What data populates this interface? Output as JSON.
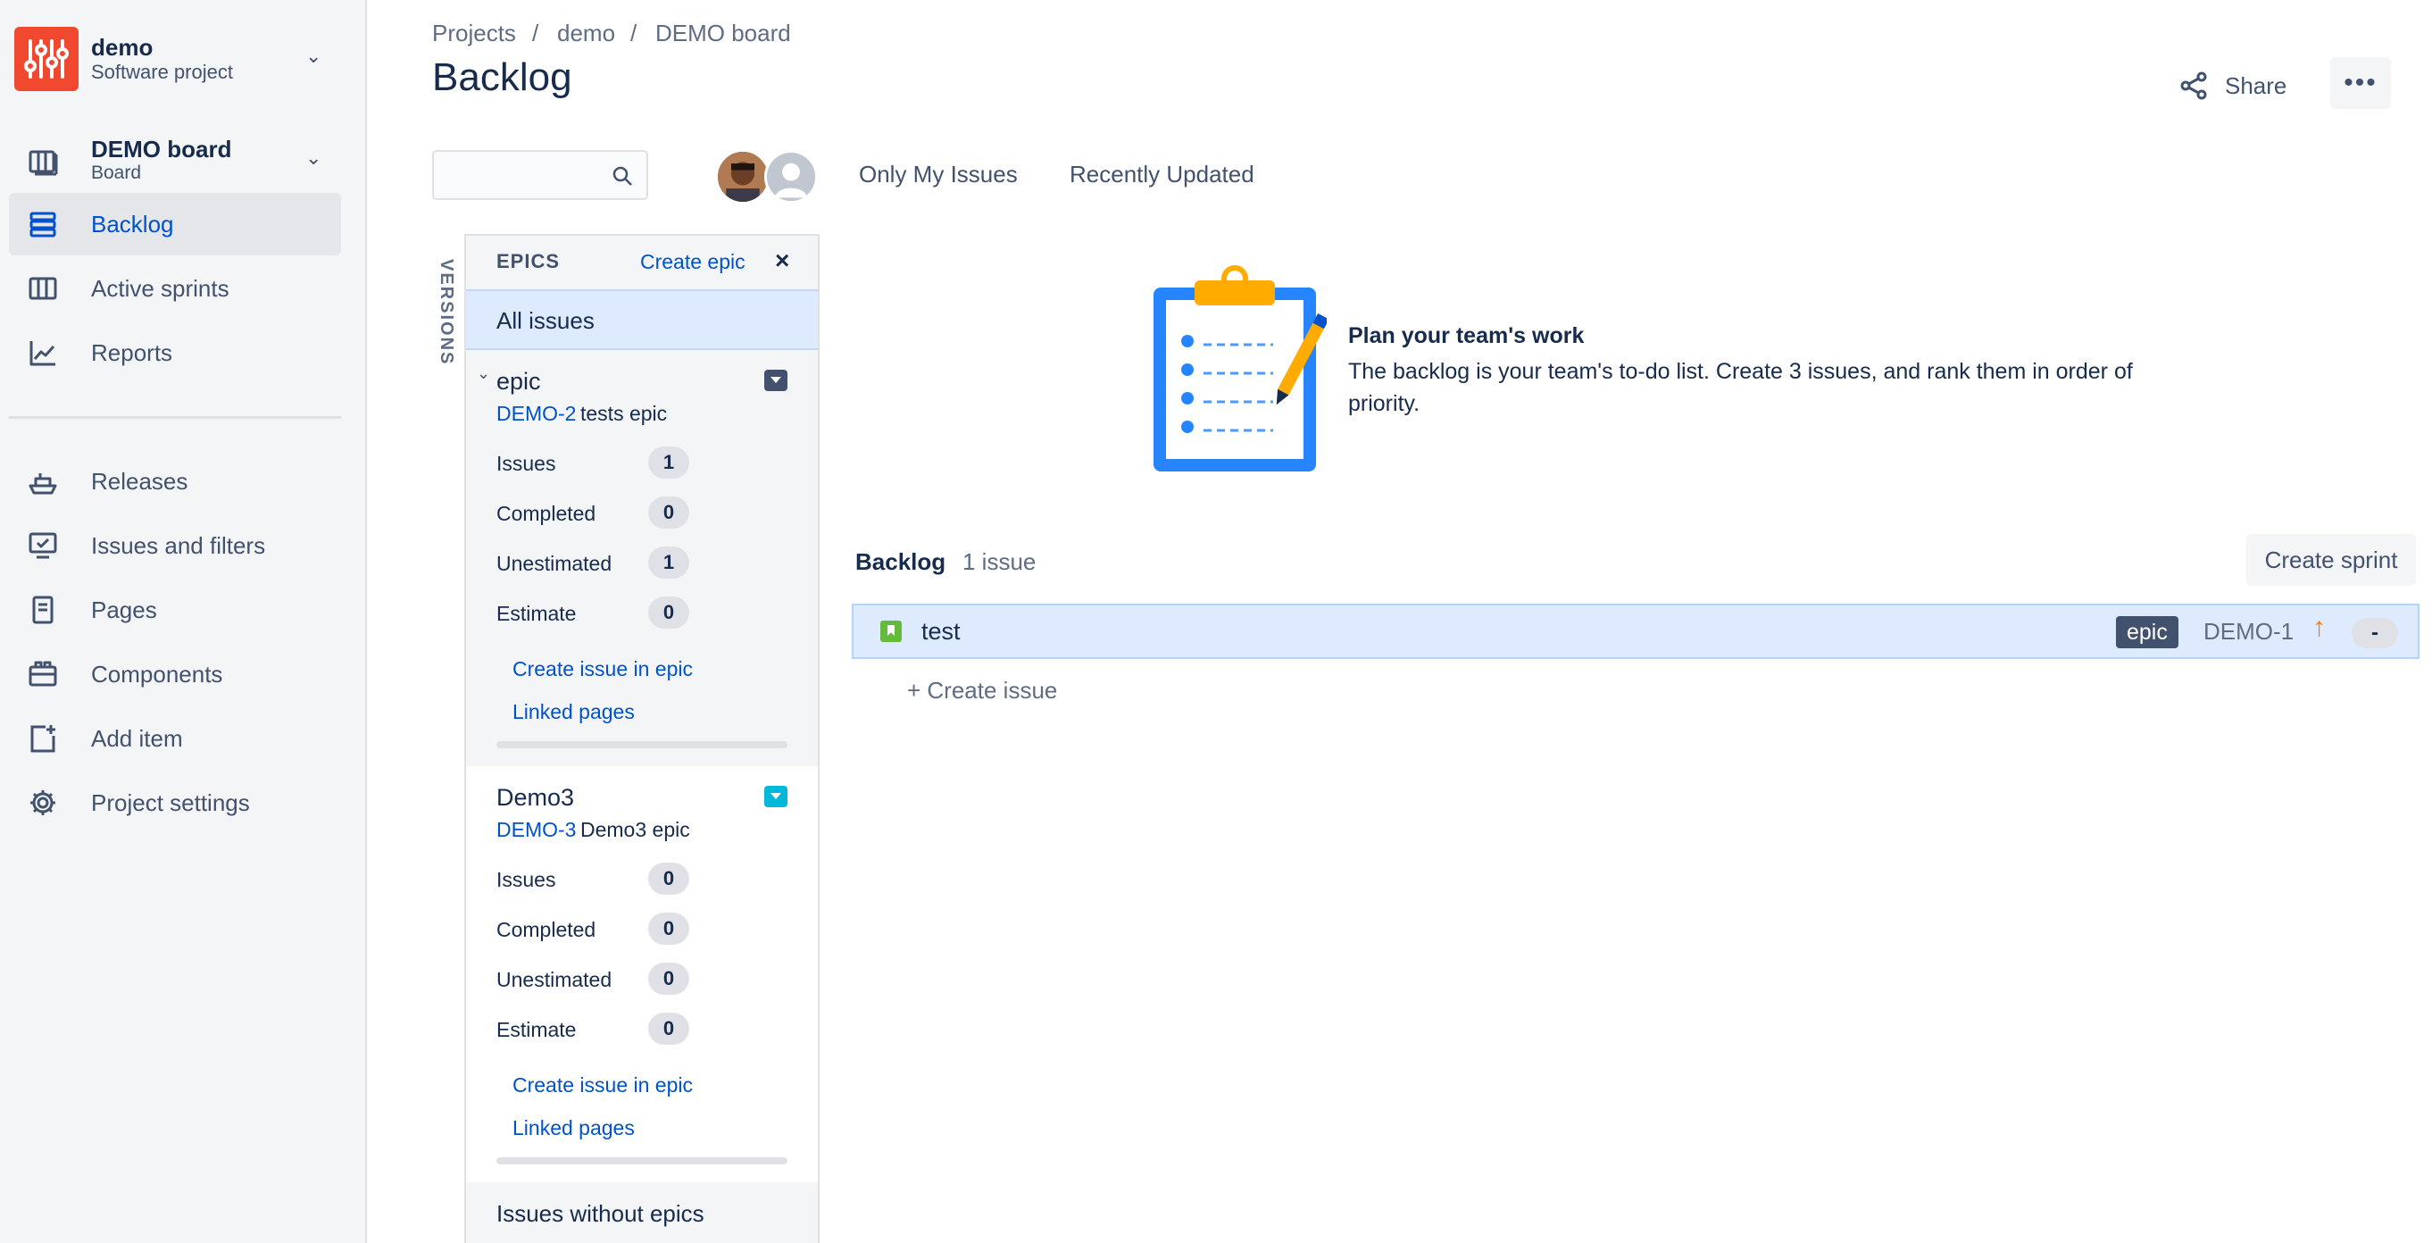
{
  "project": {
    "name": "demo",
    "type": "Software project"
  },
  "board": {
    "name": "DEMO board",
    "type": "Board"
  },
  "nav": {
    "backlog": "Backlog",
    "active_sprints": "Active sprints",
    "reports": "Reports",
    "releases": "Releases",
    "issues_filters": "Issues and filters",
    "pages": "Pages",
    "components": "Components",
    "add_item": "Add item",
    "project_settings": "Project settings"
  },
  "breadcrumbs": [
    "Projects",
    "demo",
    "DEMO board"
  ],
  "breadcrumb_sep": "/",
  "page_title": "Backlog",
  "header": {
    "share": "Share",
    "more": "•••"
  },
  "quick_filters": [
    "Only My Issues",
    "Recently Updated"
  ],
  "versions_tab": "VERSIONS",
  "epics_panel": {
    "heading": "EPICS",
    "create": "Create epic",
    "close": "×",
    "all_issues": "All issues",
    "epics": [
      {
        "name": "epic",
        "key": "DEMO-2",
        "desc": "tests epic",
        "color": "#42526e",
        "stats": [
          {
            "label": "Issues",
            "value": "1"
          },
          {
            "label": "Completed",
            "value": "0"
          },
          {
            "label": "Unestimated",
            "value": "1"
          },
          {
            "label": "Estimate",
            "value": "0"
          }
        ],
        "create_link": "Create issue in epic",
        "linked_pages": "Linked pages"
      },
      {
        "name": "Demo3",
        "key": "DEMO-3",
        "desc": "Demo3 epic",
        "color": "#00b8d9",
        "stats": [
          {
            "label": "Issues",
            "value": "0"
          },
          {
            "label": "Completed",
            "value": "0"
          },
          {
            "label": "Unestimated",
            "value": "0"
          },
          {
            "label": "Estimate",
            "value": "0"
          }
        ],
        "create_link": "Create issue in epic",
        "linked_pages": "Linked pages"
      }
    ],
    "issues_without_epics": "Issues without epics"
  },
  "empty_state": {
    "title": "Plan your team's work",
    "text": "The backlog is your team's to-do list. Create 3 issues, and rank them in order of priority."
  },
  "backlog": {
    "title": "Backlog",
    "count": "1 issue",
    "create_sprint": "Create sprint",
    "issues": [
      {
        "summary": "test",
        "epic": "epic",
        "key": "DEMO-1",
        "priority": "↑",
        "estimate": "-"
      }
    ],
    "create_issue": "+  Create issue"
  },
  "colors": {
    "accent": "#0052cc",
    "logo": "#f0492f",
    "selected": "#deebff",
    "story": "#63ba3c",
    "priority_high": "#ff7a00"
  }
}
